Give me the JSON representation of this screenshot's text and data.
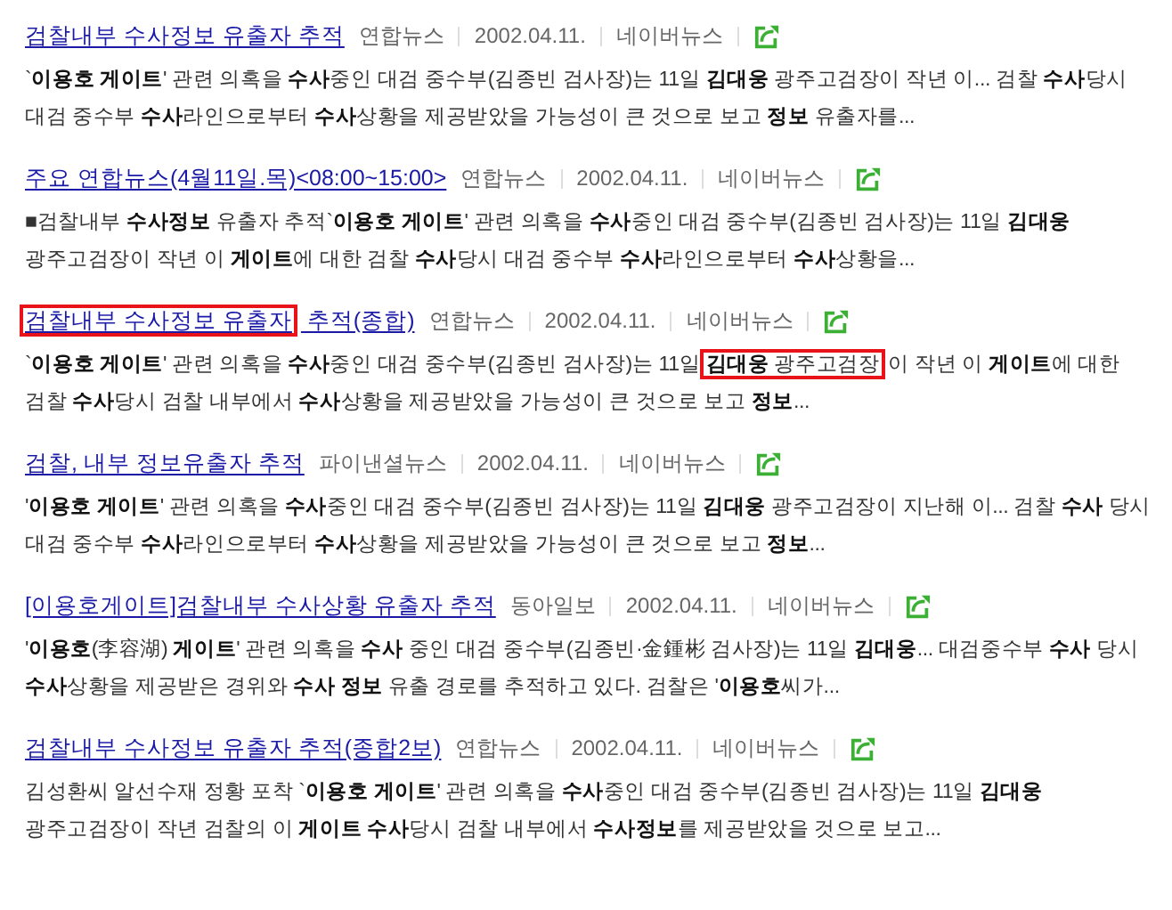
{
  "results": [
    {
      "title": [
        {
          "text": "검찰내부 수사정보 유출자 추적",
          "boxed": false
        }
      ],
      "source": "연합뉴스",
      "date": "2002.04.11.",
      "portal": "네이버뉴스",
      "snippet": [
        {
          "text": "`**이용호 게이트**' 관련 의혹을 **수사**중인 대검 중수부(김종빈 검사장)는 11일 **김대웅** 광주고검장이 작년 이... 검찰 **수사**당시 대검 중수부 **수사**라인으로부터 **수사**상황을 제공받았을 가능성이 큰 것으로 보고 **정보** 유출자를...",
          "boxed": false
        }
      ]
    },
    {
      "title": [
        {
          "text": "주요 연합뉴스(4월11일.목)<08:00~15:00>",
          "boxed": false
        }
      ],
      "source": "연합뉴스",
      "date": "2002.04.11.",
      "portal": "네이버뉴스",
      "snippet": [
        {
          "text": "■검찰내부 **수사정보** 유출자 추적`**이용호 게이트**' 관련 의혹을 **수사**중인 대검 중수부(김종빈 검사장)는 11일 **김대웅** 광주고검장이 작년 이 **게이트**에 대한 검찰 **수사**당시 대검 중수부 **수사**라인으로부터 **수사**상황을...",
          "boxed": false
        }
      ]
    },
    {
      "title": [
        {
          "text": "검찰내부 수사정보 유출자",
          "boxed": true
        },
        {
          "text": " 추적(종합)",
          "boxed": false
        }
      ],
      "source": "연합뉴스",
      "date": "2002.04.11.",
      "portal": "네이버뉴스",
      "snippet": [
        {
          "text": "`**이용호 게이트**' 관련 의혹을 **수사**중인 대검 중수부(김종빈 검사장)는 11일 ",
          "boxed": false
        },
        {
          "text": "**김대웅** 광주고검장",
          "boxed": true
        },
        {
          "text": "이 작년 이 **게이트**에 대한 검찰 **수사**당시 검찰 내부에서 **수사**상황을 제공받았을 가능성이 큰 것으로 보고 **정보**...",
          "boxed": false
        }
      ]
    },
    {
      "title": [
        {
          "text": "검찰, 내부 정보유출자 추적",
          "boxed": false
        }
      ],
      "source": "파이낸셜뉴스",
      "date": "2002.04.11.",
      "portal": "네이버뉴스",
      "snippet": [
        {
          "text": "'**이용호 게이트**' 관련 의혹을 **수사**중인 대검 중수부(김종빈 검사장)는 11일 **김대웅** 광주고검장이 지난해 이... 검찰 **수사** 당시 대검 중수부 **수사**라인으로부터 **수사**상황을 제공받았을 가능성이 큰 것으로 보고 **정보**...",
          "boxed": false
        }
      ]
    },
    {
      "title": [
        {
          "text": "[이용호게이트]검찰내부 수사상황 유출자 추적",
          "boxed": false
        }
      ],
      "source": "동아일보",
      "date": "2002.04.11.",
      "portal": "네이버뉴스",
      "snippet": [
        {
          "text": "'**이용호**(李容湖) **게이트**' 관련 의혹을 **수사** 중인 대검 중수부(김종빈·金鍾彬 검사장)는 11일 **김대웅**... 대검중수부 **수사** 당시 **수사**상황을 제공받은 경위와 **수사 정보** 유출 경로를 추적하고 있다. 검찰은 '**이용호**씨가...",
          "boxed": false
        }
      ]
    },
    {
      "title": [
        {
          "text": "검찰내부 수사정보 유출자 추적(종합2보)",
          "boxed": false
        }
      ],
      "source": "연합뉴스",
      "date": "2002.04.11.",
      "portal": "네이버뉴스",
      "snippet": [
        {
          "text": "김성환씨 알선수재 정황 포착 `**이용호 게이트**' 관련 의혹을 **수사**중인 대검 중수부(김종빈 검사장)는 11일 **김대웅** 광주고검장이 작년 검찰의 이 **게이트 수사**당시 검찰 내부에서 **수사정보**를 제공받았을 것으로 보고...",
          "boxed": false
        }
      ]
    }
  ]
}
